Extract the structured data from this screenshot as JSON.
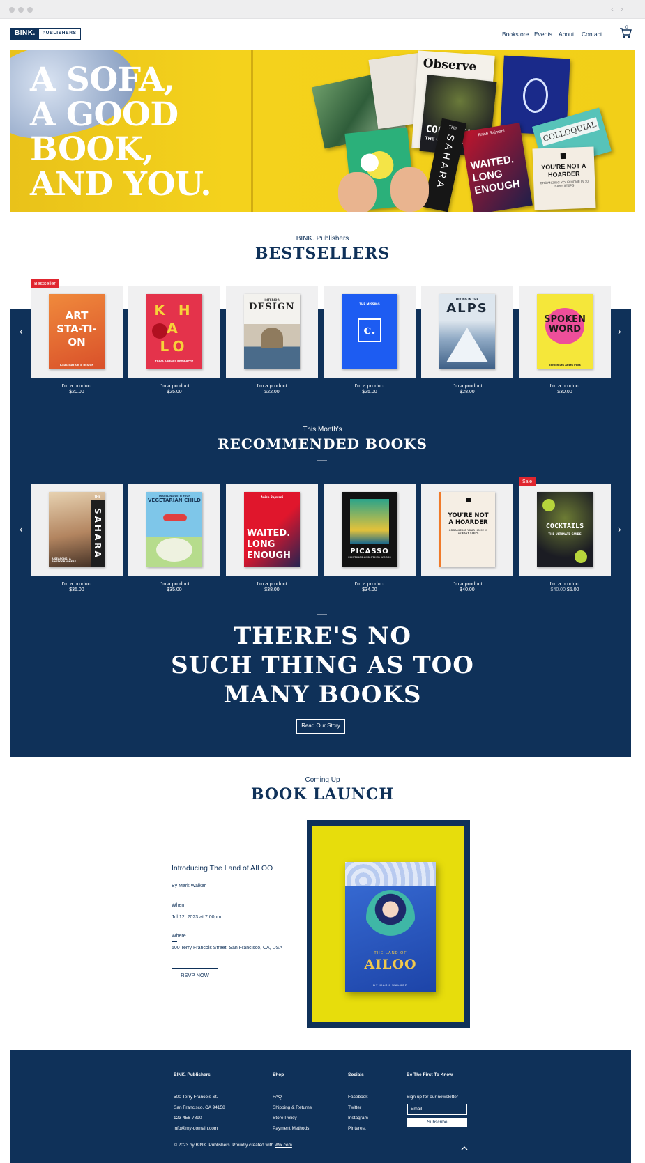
{
  "browser": {
    "back_icon": "chevron-left-icon",
    "forward_icon": "chevron-right-icon"
  },
  "header": {
    "logo_main": "BINK.",
    "logo_sub": "PUBLISHERS",
    "nav": [
      "Bookstore",
      "Events",
      "About",
      "Contact"
    ],
    "cart_count": "0"
  },
  "hero": {
    "headline": [
      "A SOFA,",
      "A GOOD",
      "BOOK,",
      "AND YOU."
    ],
    "books": {
      "observe": "Observe",
      "cocktails": "COCKTAILS",
      "cocktails_sub": "THE ULTIMATE GUIDE",
      "waited": "WAITED. LONG ENOUGH",
      "waited_author": "Anish Rajmani",
      "colloquial": "COLLOQUIAL",
      "hoarder": "YOU'RE NOT A HOARDER",
      "hoarder_sub": "ORGANIZING YOUR HOME IN 10 EASY STEPS",
      "sahara": "SAHARA",
      "sahara_the": "THE"
    }
  },
  "bestsellers": {
    "kicker": "BINK. Publishers",
    "title": "BESTSELLERS",
    "badge": "Bestseller",
    "products": [
      {
        "name": "I'm a product",
        "price": "$20.00",
        "cover_text": "ART STA-TI-ON",
        "cover_sub": "ILLUSTRATION & DESIGN"
      },
      {
        "name": "I'm a product",
        "price": "$25.00",
        "cover_text": "K H A LO",
        "cover_sub": "FRIDA KAHLO'S BIOGRAPHY"
      },
      {
        "name": "I'm a product",
        "price": "$22.00",
        "cover_text": "DESIGN",
        "cover_sub": "INTERIOR"
      },
      {
        "name": "I'm a product",
        "price": "$25.00",
        "cover_text": "c.",
        "cover_sub": "THE MISSING"
      },
      {
        "name": "I'm a product",
        "price": "$28.00",
        "cover_text": "ALPS",
        "cover_sub": "HIKING IN THE"
      },
      {
        "name": "I'm a product",
        "price": "$30.00",
        "cover_text": "SPOKEN WORD",
        "cover_sub": "Edition Les Anses Pods"
      }
    ]
  },
  "recommended": {
    "kicker": "This Month's",
    "title": "RECOMMENDED BOOKS",
    "badge": "Sale",
    "products": [
      {
        "name": "I'm a product",
        "price": "$35.00",
        "cover_text": "SAHARA",
        "cover_sub": "A SEASONS, A PHOTOGRAPHERS",
        "cover_the": "THE"
      },
      {
        "name": "I'm a product",
        "price": "$35.00",
        "cover_text": "VEGETARIAN CHILD",
        "cover_sub": "TRAVELING WITH YOUR"
      },
      {
        "name": "I'm a product",
        "price": "$38.00",
        "cover_text": "WAITED. LONG ENOUGH",
        "cover_sub": "Anish Rajmani"
      },
      {
        "name": "I'm a product",
        "price": "$34.00",
        "cover_text": "PICASSO",
        "cover_sub": "PAINTINGS AND OTHER WORKS"
      },
      {
        "name": "I'm a product",
        "price": "$40.00",
        "cover_text": "YOU'RE NOT A HOARDER",
        "cover_sub": "ORGANIZING YOUR HOME IN 10 EASY STEPS"
      },
      {
        "name": "I'm a product",
        "price": "$5.00",
        "old_price": "$40.00",
        "cover_text": "COCKTAILS",
        "cover_sub": "THE ULTIMATE GUIDE"
      }
    ]
  },
  "story": {
    "headline": [
      "THERE'S NO",
      "SUCH THING AS TOO",
      "MANY BOOKS"
    ],
    "button": "Read Our Story"
  },
  "launch": {
    "kicker": "Coming Up",
    "title": "BOOK LAUNCH",
    "event_title": "Introducing The Land of AILOO",
    "by": "By Mark Walker",
    "when_label": "When",
    "when_value": "Jul 12, 2023 at 7:00pm",
    "where_label": "Where",
    "where_value": "500 Terry Francois Street, San Francisco, CA, USA",
    "button": "RSVP NOW",
    "cover_small": "THE LAND OF",
    "cover_title": "AILOO",
    "cover_author": "BY MARK WALKER"
  },
  "footer": {
    "brand": {
      "heading": "BINK. Publishers",
      "lines": [
        "500 Terry Francois St.",
        "San Francisco, CA 94158",
        "123-456-7890",
        "info@my-domain.com"
      ]
    },
    "shop": {
      "heading": "Shop",
      "links": [
        "FAQ",
        "Shipping & Returns",
        "Store Policy",
        "Payment Methods"
      ]
    },
    "socials": {
      "heading": "Socials",
      "links": [
        "Facebook",
        "Twitter",
        "Instagram",
        "Pinterest"
      ]
    },
    "newsletter": {
      "heading": "Be The First To Know",
      "text": "Sign up for our newsletter",
      "email_placeholder": "Email",
      "button": "Subscribe"
    },
    "copyright": "© 2023 by BINK. Publishers. Proudly created with",
    "copyright_link": "Wix.com"
  },
  "colors": {
    "navy": "#0f3159",
    "hero_yellow": "#f2cf18",
    "badge_red": "#e0262f"
  }
}
